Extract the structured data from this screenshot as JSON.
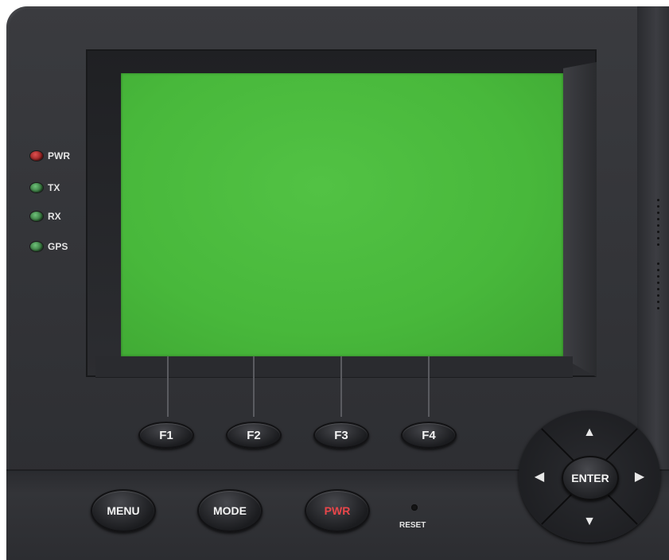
{
  "leds": [
    {
      "label": "PWR",
      "color": "#b02a2a"
    },
    {
      "label": "TX",
      "color": "#3f8a48"
    },
    {
      "label": "RX",
      "color": "#3f8a48"
    },
    {
      "label": "GPS",
      "color": "#3f8a48"
    }
  ],
  "screen": {
    "color": "#4cbc3f"
  },
  "function_keys": [
    {
      "label": "F1"
    },
    {
      "label": "F2"
    },
    {
      "label": "F3"
    },
    {
      "label": "F4"
    }
  ],
  "bottom_keys": {
    "menu": "MENU",
    "mode": "MODE",
    "power": "PWR",
    "reset": "RESET"
  },
  "nav_pad": {
    "center": "ENTER",
    "up_icon": "up-arrow-icon",
    "down_icon": "down-arrow-icon",
    "left_icon": "left-arrow-icon",
    "right_icon": "right-arrow-icon"
  },
  "colors": {
    "body": "#333438",
    "power_label": "#e8464a"
  }
}
